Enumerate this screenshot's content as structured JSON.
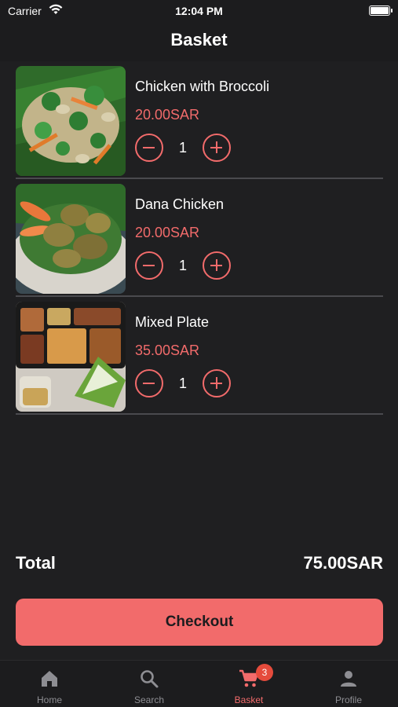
{
  "status_bar": {
    "carrier": "Carrier",
    "time": "12:04 PM"
  },
  "header": {
    "title": "Basket"
  },
  "items": [
    {
      "name": "Chicken with Broccoli",
      "price": "20.00SAR",
      "quantity": "1"
    },
    {
      "name": "Dana Chicken",
      "price": "20.00SAR",
      "quantity": "1"
    },
    {
      "name": "Mixed Plate",
      "price": "35.00SAR",
      "quantity": "1"
    }
  ],
  "summary": {
    "total_label": "Total",
    "total_value": "75.00SAR"
  },
  "checkout_label": "Checkout",
  "tabs": [
    {
      "label": "Home",
      "icon": "home-icon"
    },
    {
      "label": "Search",
      "icon": "search-icon"
    },
    {
      "label": "Basket",
      "icon": "cart-icon",
      "badge": "3",
      "active": true
    },
    {
      "label": "Profile",
      "icon": "person-icon"
    }
  ],
  "colors": {
    "accent": "#f26b6b",
    "background": "#1f1f21",
    "bar": "#1c1c1e",
    "badge": "#e54b3c",
    "inactive": "#8e8e93"
  }
}
